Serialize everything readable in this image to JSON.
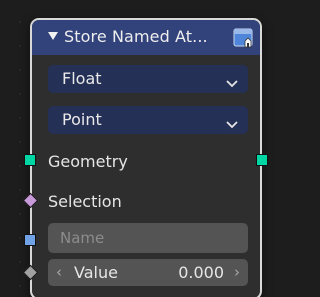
{
  "node": {
    "title": "Store Named At...",
    "header_color": "#32427a",
    "collapse_icon": "triangle-down-icon",
    "header_icon": "node-preview-icon"
  },
  "data_type": {
    "selected": "Float",
    "icon": "chevron-down-icon"
  },
  "domain": {
    "selected": "Point",
    "icon": "chevron-down-icon"
  },
  "sockets": {
    "geometry": {
      "label": "Geometry",
      "color": "#00d6a3"
    },
    "selection": {
      "label": "Selection",
      "color": "#c99ad9"
    },
    "name": {
      "placeholder": "Name",
      "color": "#6fa3e6"
    },
    "value": {
      "label": "Value",
      "value": "0.000",
      "color": "#a1a1a1",
      "left_arrow": "‹",
      "right_arrow": "›"
    }
  }
}
